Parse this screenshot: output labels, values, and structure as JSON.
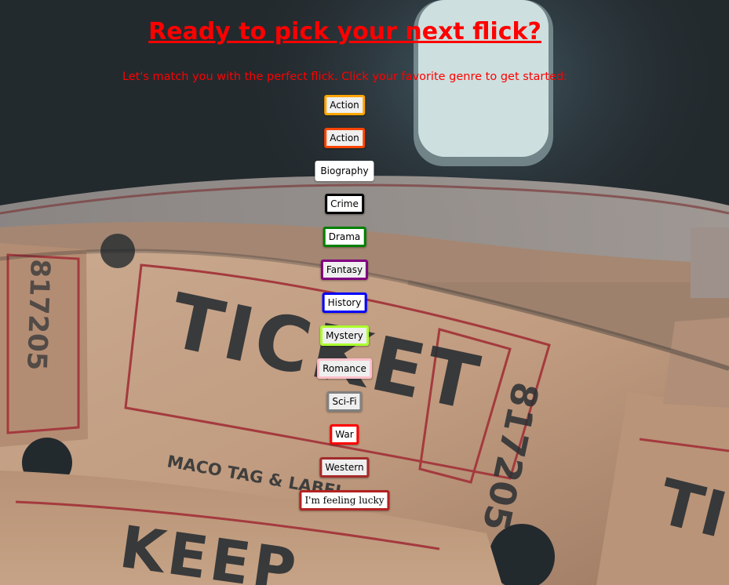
{
  "page": {
    "title": "Ready to pick your next flick?",
    "subtitle": "Let's match you with the perfect flick. Click your favorite genre to get started:",
    "text_color": "#ff0000"
  },
  "genres": [
    {
      "label": "Action",
      "border_color": "#ffa500"
    },
    {
      "label": "Action",
      "border_color": "#ff4500"
    },
    {
      "label": "Biography",
      "border_color": "#ffffff"
    },
    {
      "label": "Crime",
      "border_color": "#000000"
    },
    {
      "label": "Drama",
      "border_color": "#008000"
    },
    {
      "label": "Fantasy",
      "border_color": "#800080"
    },
    {
      "label": "History",
      "border_color": "#0000ff"
    },
    {
      "label": "Mystery",
      "border_color": "#adff2f"
    },
    {
      "label": "Romance",
      "border_color": "#ffc0cb"
    },
    {
      "label": "Sci-Fi",
      "border_color": "#808080"
    },
    {
      "label": "War",
      "border_color": "#ff0000"
    },
    {
      "label": "Western",
      "border_color": "#a52a2a"
    }
  ],
  "lucky": {
    "label": "I'm feeling lucky",
    "border_color": "#b22222"
  },
  "background_image": {
    "icon": "ticket-roll-photo"
  }
}
